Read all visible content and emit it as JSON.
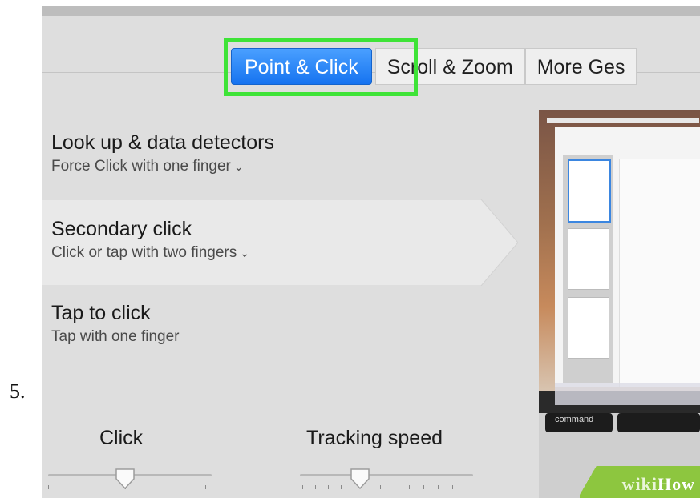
{
  "step_label": "5.",
  "tabs": [
    {
      "label": "Point & Click",
      "active": true
    },
    {
      "label": "Scroll & Zoom",
      "active": false
    },
    {
      "label": "More Ges",
      "active": false
    }
  ],
  "options": [
    {
      "title": "Look up & data detectors",
      "subtitle": "Force Click with one finger",
      "has_dropdown": true
    },
    {
      "title": "Secondary click",
      "subtitle": "Click or tap with two fingers",
      "has_dropdown": true,
      "selected": true
    },
    {
      "title": "Tap to click",
      "subtitle": "Tap with one finger",
      "has_dropdown": false
    }
  ],
  "sliders": {
    "click": {
      "label": "Click"
    },
    "tracking": {
      "label": "Tracking speed"
    }
  },
  "preview": {
    "key_label": "command"
  },
  "watermark": {
    "wiki": "wiki",
    "how": "How"
  },
  "colors": {
    "accent": "#1a78f2",
    "highlight": "#3ee337",
    "panel": "#dedede",
    "watermark": "#8dc63f"
  },
  "icons": {
    "dropdown": "chevron-down-icon",
    "slider_thumb": "slider-thumb-icon"
  }
}
